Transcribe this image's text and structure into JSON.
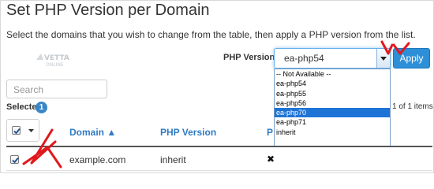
{
  "page": {
    "title": "Set PHP Version per Domain",
    "description": "Select the domains that you wish to change from the table, then apply a PHP version from the list.",
    "watermark": "VETTA ONLINE"
  },
  "php_selector": {
    "label": "PHP Version",
    "current_value": "ea-php54",
    "apply_label": "Apply",
    "options": [
      {
        "label": "-- Not Available --",
        "highlighted": false
      },
      {
        "label": "ea-php54",
        "highlighted": false
      },
      {
        "label": "ea-php55",
        "highlighted": false
      },
      {
        "label": "ea-php56",
        "highlighted": false
      },
      {
        "label": "ea-php70",
        "highlighted": true
      },
      {
        "label": "ea-php71",
        "highlighted": false
      },
      {
        "label": "inherit",
        "highlighted": false
      }
    ]
  },
  "search": {
    "placeholder": "Search"
  },
  "selection": {
    "label": "Selected",
    "count": "1"
  },
  "pagination": {
    "info": "1 of 1 items"
  },
  "table": {
    "columns": [
      {
        "label": "Domain ▲"
      },
      {
        "label": "PHP Version"
      },
      {
        "label": "PHP-FPM"
      }
    ],
    "rows": [
      {
        "domain": "example.com",
        "php_version": "inherit",
        "fpm": "✖",
        "checked": true
      }
    ]
  },
  "colors": {
    "accent": "#2d8fd8",
    "link": "#2f7bc4",
    "highlight": "#1e74d6",
    "annotation_arrow": "#e0191e"
  }
}
